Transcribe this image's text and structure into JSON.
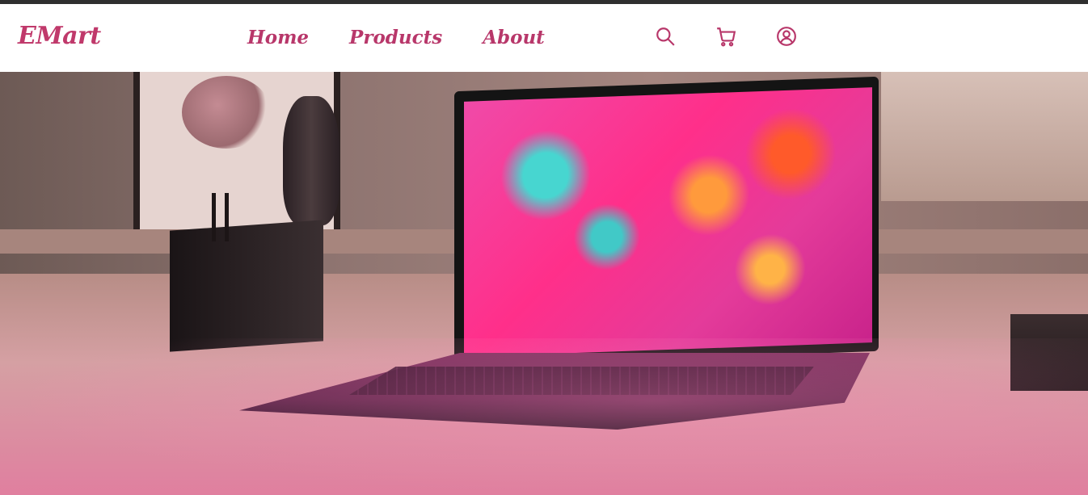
{
  "brand": {
    "name": "EMart"
  },
  "nav": {
    "links": [
      {
        "label": "Home"
      },
      {
        "label": "Products"
      },
      {
        "label": "About"
      }
    ],
    "icons": [
      {
        "name": "search-icon"
      },
      {
        "name": "cart-icon"
      },
      {
        "name": "user-icon"
      }
    ]
  },
  "colors": {
    "topbar": "#2f2f2f",
    "accent": "#b8376a",
    "nav_background": "#ffffff"
  },
  "hero": {
    "image_subject": "laptop"
  }
}
